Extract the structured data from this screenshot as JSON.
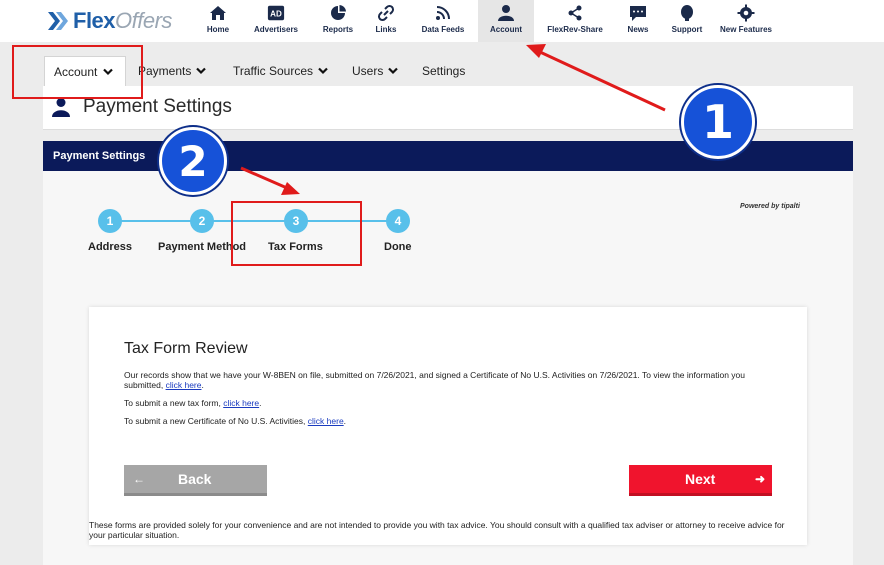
{
  "brand": {
    "part1": "Flex",
    "part2": "Offers"
  },
  "nav": [
    {
      "label": "Home",
      "icon": "home-icon"
    },
    {
      "label": "Advertisers",
      "icon": "ad-icon",
      "badge": "AD"
    },
    {
      "label": "Reports",
      "icon": "pie-chart-icon"
    },
    {
      "label": "Links",
      "icon": "link-icon"
    },
    {
      "label": "Data Feeds",
      "icon": "rss-icon"
    },
    {
      "label": "Account",
      "icon": "user-icon",
      "active": true
    },
    {
      "label": "FlexRev-Share",
      "icon": "share-icon"
    },
    {
      "label": "News",
      "icon": "chat-icon"
    },
    {
      "label": "Support",
      "icon": "support-icon"
    },
    {
      "label": "New Features",
      "icon": "gear-icon"
    }
  ],
  "subtabs": {
    "account": "Account",
    "payments": "Payments",
    "traffic": "Traffic Sources",
    "users": "Users",
    "settings": "Settings"
  },
  "page_title": "Payment Settings",
  "section_title": "Payment Settings",
  "powered_by": "Powered by tipalti",
  "steps": [
    {
      "num": "1",
      "label": "Address"
    },
    {
      "num": "2",
      "label": "Payment Method"
    },
    {
      "num": "3",
      "label": "Tax Forms"
    },
    {
      "num": "4",
      "label": "Done"
    }
  ],
  "review": {
    "title": "Tax Form Review",
    "p1": "Our records show that we have your W-8BEN on file, submitted on 7/26/2021, and signed a Certificate of No U.S. Activities on 7/26/2021. To view the information you submitted, ",
    "p1_link": "click here",
    "p2": "To submit a new tax form, ",
    "p2_link": "click here",
    "p3": "To submit a new Certificate of No U.S. Activities, ",
    "p3_link": "click here"
  },
  "buttons": {
    "back": "Back",
    "next": "Next"
  },
  "disclaimer": "These forms are provided solely for your convenience and are not intended to provide you with tax advice. You should consult with a qualified tax adviser or attorney to receive advice for your particular situation.",
  "annotations": {
    "badge1": "1",
    "badge2": "2"
  },
  "colors": {
    "brand_blue": "#1f5fa8",
    "section_navy": "#0b1a5a",
    "step_blue": "#58c0ea",
    "next_red": "#f0142d",
    "annotation_red": "#e01b1b"
  }
}
